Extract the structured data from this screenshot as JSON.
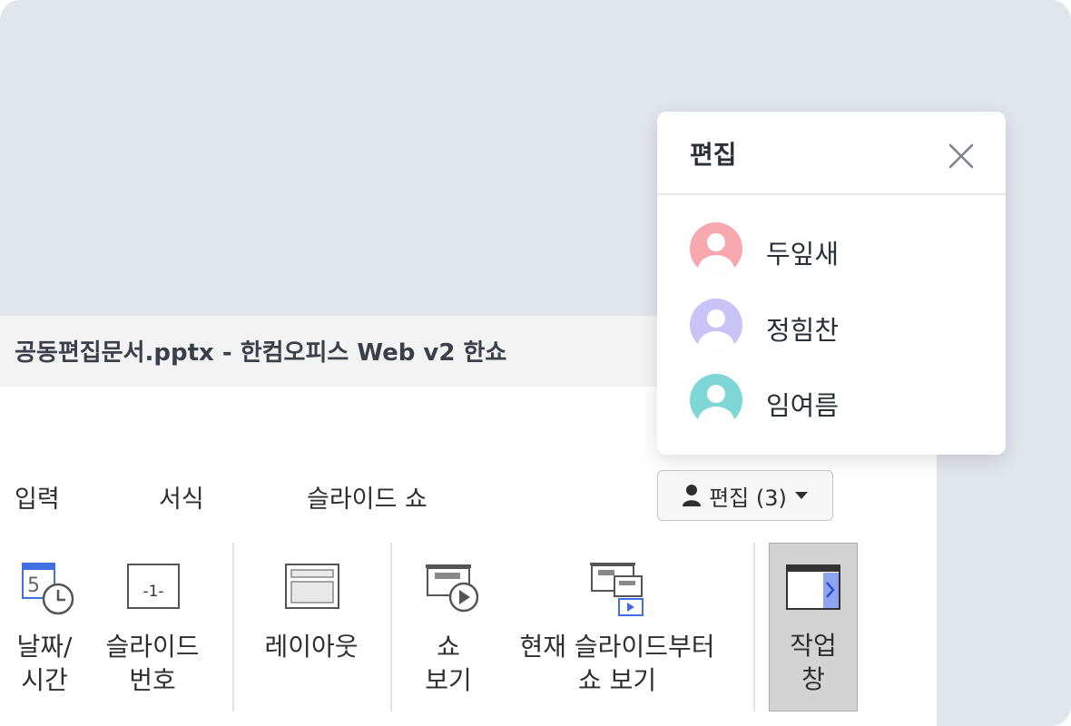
{
  "window": {
    "title": "공동편집문서.pptx - 한컴오피스 Web v2 한쇼"
  },
  "menu": {
    "items": [
      {
        "label": "입력"
      },
      {
        "label": "서식"
      },
      {
        "label": "슬라이드 쇼"
      }
    ]
  },
  "editors_button": {
    "label": "편집 (3)"
  },
  "toolbar": {
    "date_time": {
      "line1": "날짜/",
      "line2": "시간"
    },
    "slide_number": {
      "line1": "슬라이드",
      "line2": "번호",
      "icon_text": "-1-",
      "calendar_digit": "5"
    },
    "layout": {
      "line1": "레이아웃"
    },
    "show_view": {
      "line1": "쇼",
      "line2": "보기"
    },
    "from_current": {
      "line1": "현재 슬라이드부터",
      "line2": "쇼 보기"
    },
    "task_pane": {
      "line1": "작업",
      "line2": "창"
    }
  },
  "popup": {
    "title": "편집",
    "users": [
      {
        "name": "두잎새",
        "color": "#f7a8ae"
      },
      {
        "name": "정힘찬",
        "color": "#c9c3f7"
      },
      {
        "name": "임여름",
        "color": "#7fd6d6"
      }
    ]
  },
  "colors": {
    "background": "#e1e5ec",
    "icon_blue": "#3f6fe0",
    "active_tool": "#d3d3d3"
  }
}
